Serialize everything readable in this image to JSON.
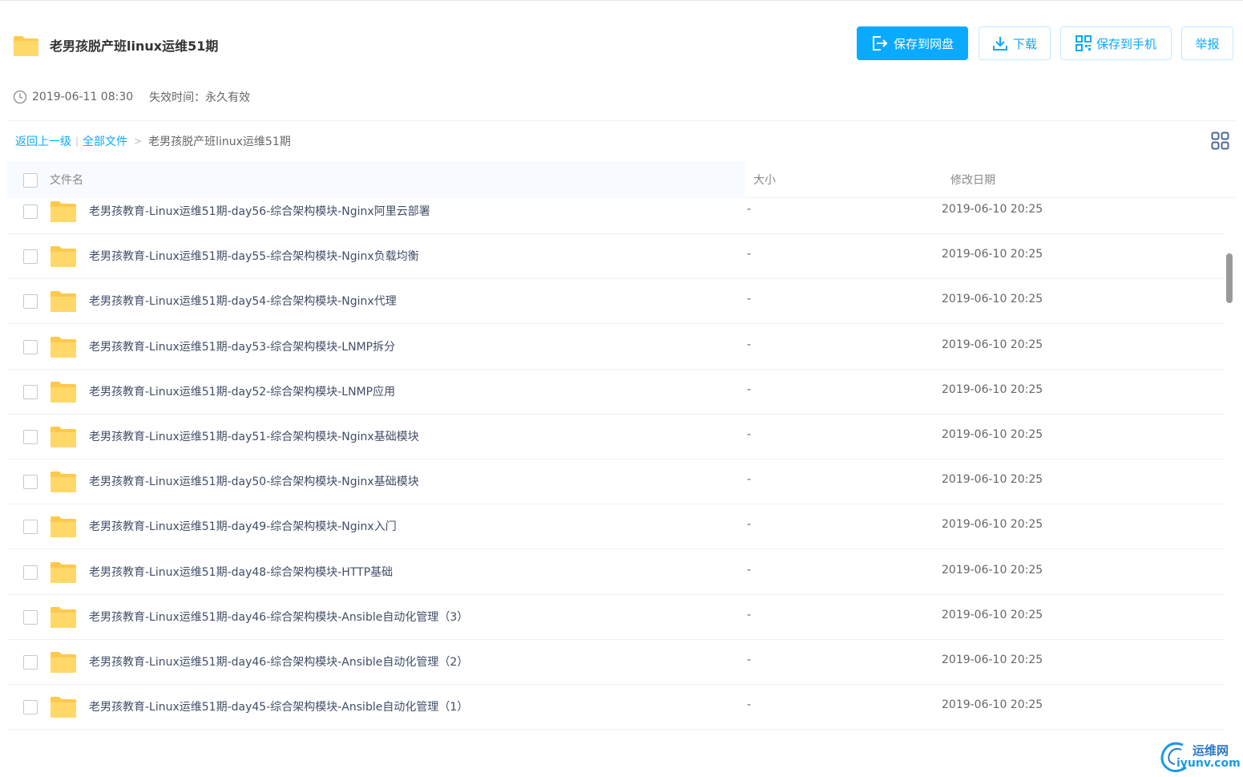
{
  "share": {
    "title": "老男孩脱产班linux运维51期",
    "created": "2019-06-11 08:30",
    "expire_label": "失效时间：",
    "expire_value": "永久有效"
  },
  "actions": {
    "save_to_disk": "保存到网盘",
    "download": "下载",
    "save_to_phone": "保存到手机",
    "report": "举报"
  },
  "breadcrumb": {
    "back": "返回上一级",
    "all_files": "全部文件",
    "current": "老男孩脱产班linux运维51期"
  },
  "columns": {
    "name": "文件名",
    "size": "大小",
    "date": "修改日期"
  },
  "files": [
    {
      "name": "老男孩教育-Linux运维51期-day56-综合架构模块-Nginx阿里云部署",
      "size": "-",
      "date": "2019-06-10 20:25"
    },
    {
      "name": "老男孩教育-Linux运维51期-day55-综合架构模块-Nginx负载均衡",
      "size": "-",
      "date": "2019-06-10 20:25"
    },
    {
      "name": "老男孩教育-Linux运维51期-day54-综合架构模块-Nginx代理",
      "size": "-",
      "date": "2019-06-10 20:25"
    },
    {
      "name": "老男孩教育-Linux运维51期-day53-综合架构模块-LNMP拆分",
      "size": "-",
      "date": "2019-06-10 20:25"
    },
    {
      "name": "老男孩教育-Linux运维51期-day52-综合架构模块-LNMP应用",
      "size": "-",
      "date": "2019-06-10 20:25"
    },
    {
      "name": "老男孩教育-Linux运维51期-day51-综合架构模块-Nginx基础模块",
      "size": "-",
      "date": "2019-06-10 20:25"
    },
    {
      "name": "老男孩教育-Linux运维51期-day50-综合架构模块-Nginx基础模块",
      "size": "-",
      "date": "2019-06-10 20:25"
    },
    {
      "name": "老男孩教育-Linux运维51期-day49-综合架构模块-Nginx入门",
      "size": "-",
      "date": "2019-06-10 20:25"
    },
    {
      "name": "老男孩教育-Linux运维51期-day48-综合架构模块-HTTP基础",
      "size": "-",
      "date": "2019-06-10 20:25"
    },
    {
      "name": "老男孩教育-Linux运维51期-day46-综合架构模块-Ansible自动化管理（3）",
      "size": "-",
      "date": "2019-06-10 20:25"
    },
    {
      "name": "老男孩教育-Linux运维51期-day46-综合架构模块-Ansible自动化管理（2）",
      "size": "-",
      "date": "2019-06-10 20:25"
    },
    {
      "name": "老男孩教育-Linux运维51期-day45-综合架构模块-Ansible自动化管理（1）",
      "size": "-",
      "date": "2019-06-10 20:25"
    }
  ],
  "watermark": {
    "cn": "运维网",
    "en": "iyunv.com"
  },
  "colors": {
    "accent": "#09aaff",
    "folder": "#ffc94d"
  }
}
